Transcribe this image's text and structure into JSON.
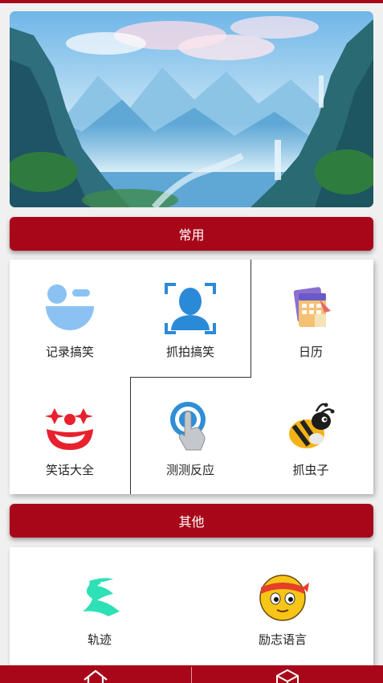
{
  "sections": [
    {
      "title": "常用",
      "items": [
        {
          "label": "记录搞笑",
          "icon": "emoji-note-icon"
        },
        {
          "label": "抓拍搞笑",
          "icon": "face-scan-icon"
        },
        {
          "label": "日历",
          "icon": "calendar-icon"
        },
        {
          "label": "笑话大全",
          "icon": "clown-icon"
        },
        {
          "label": "测测反应",
          "icon": "tap-finger-icon"
        },
        {
          "label": "抓虫子",
          "icon": "bee-icon"
        }
      ]
    },
    {
      "title": "其他",
      "items": [
        {
          "label": "轨迹",
          "icon": "track-path-icon"
        },
        {
          "label": "励志语言",
          "icon": "headband-face-icon"
        }
      ]
    }
  ],
  "bottom_nav": [
    {
      "icon": "home-icon"
    },
    {
      "icon": "box-icon"
    }
  ],
  "colors": {
    "accent": "#a8071a",
    "background": "#f0f0f0"
  }
}
